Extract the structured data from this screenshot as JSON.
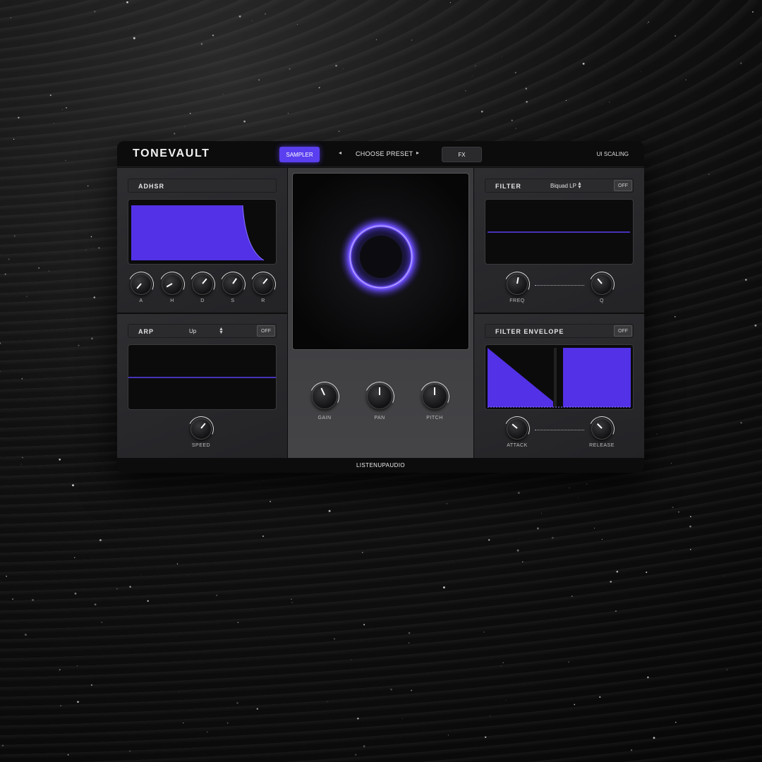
{
  "header": {
    "logo": "TONEVAULT",
    "sampler_label": "SAMPLER",
    "preset_label": "CHOOSE PRESET",
    "prev_arrow": "◂",
    "next_arrow": "▸",
    "fx_label": "FX",
    "scaling_label": "UI SCALING"
  },
  "adhsr": {
    "title": "ADHSR",
    "knobs": [
      {
        "label": "A",
        "level": 0.0
      },
      {
        "label": "H",
        "level": 0.1
      },
      {
        "label": "D",
        "level": 0.65
      },
      {
        "label": "S",
        "level": 0.6
      },
      {
        "label": "R",
        "level": 0.65
      }
    ]
  },
  "arp": {
    "title": "ARP",
    "mode": "Up",
    "off_label": "OFF",
    "speed_label": "SPEED"
  },
  "center": {
    "knobs": [
      {
        "label": "GAIN"
      },
      {
        "label": "PAN"
      },
      {
        "label": "PITCH"
      }
    ]
  },
  "filter": {
    "title": "FILTER",
    "type": "Biquad LP",
    "off_label": "OFF",
    "freq_label": "FREQ",
    "q_label": "Q"
  },
  "filter_env": {
    "title": "FILTER ENVELOPE",
    "off_label": "OFF",
    "attack_label": "ATTACK",
    "release_label": "RELEASE"
  },
  "footer": {
    "brand": "LISTENUPAUDIO"
  },
  "colors": {
    "accent": "#5a3ff0",
    "glow": "#6a4dff"
  }
}
